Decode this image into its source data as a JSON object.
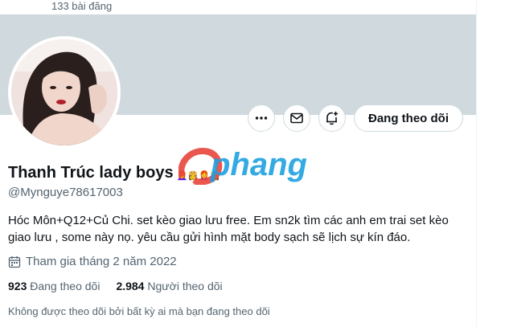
{
  "header": {
    "post_count": "133 bài đăng"
  },
  "profile": {
    "display_name": "Thanh Trúc lady boys",
    "name_emojis": "👩‍🦰👸👩‍🦰👸",
    "handle": "@Mynguye78617003",
    "bio": "Hóc Môn+Q12+Củ Chi. set kèo giao lưu free. Em sn2k tìm các anh em trai set kèo giao lưu , some này nọ. yêu cầu gửi hình mặt body sạch sẽ lịch sự kín đáo.",
    "joined": "Tham gia tháng 2 năm 2022",
    "following_count": "923",
    "following_label": "Đang theo dõi",
    "followers_count": "2.984",
    "followers_label": "Người theo dõi",
    "not_followed_note": "Không được theo dõi bởi bất kỳ ai mà bạn đang theo dõi"
  },
  "actions": {
    "more_icon": "more-horizontal-icon",
    "message_icon": "mail-icon",
    "notify_icon": "bell-plus-icon",
    "follow_label": "Đang theo dõi"
  },
  "watermark": {
    "text": "Ophang"
  },
  "colors": {
    "banner": "#cfd9de",
    "text_primary": "#0f1419",
    "text_secondary": "#536471",
    "border": "#cfd9de",
    "watermark_red": "#e8453c",
    "watermark_blue": "#1da1e0"
  }
}
